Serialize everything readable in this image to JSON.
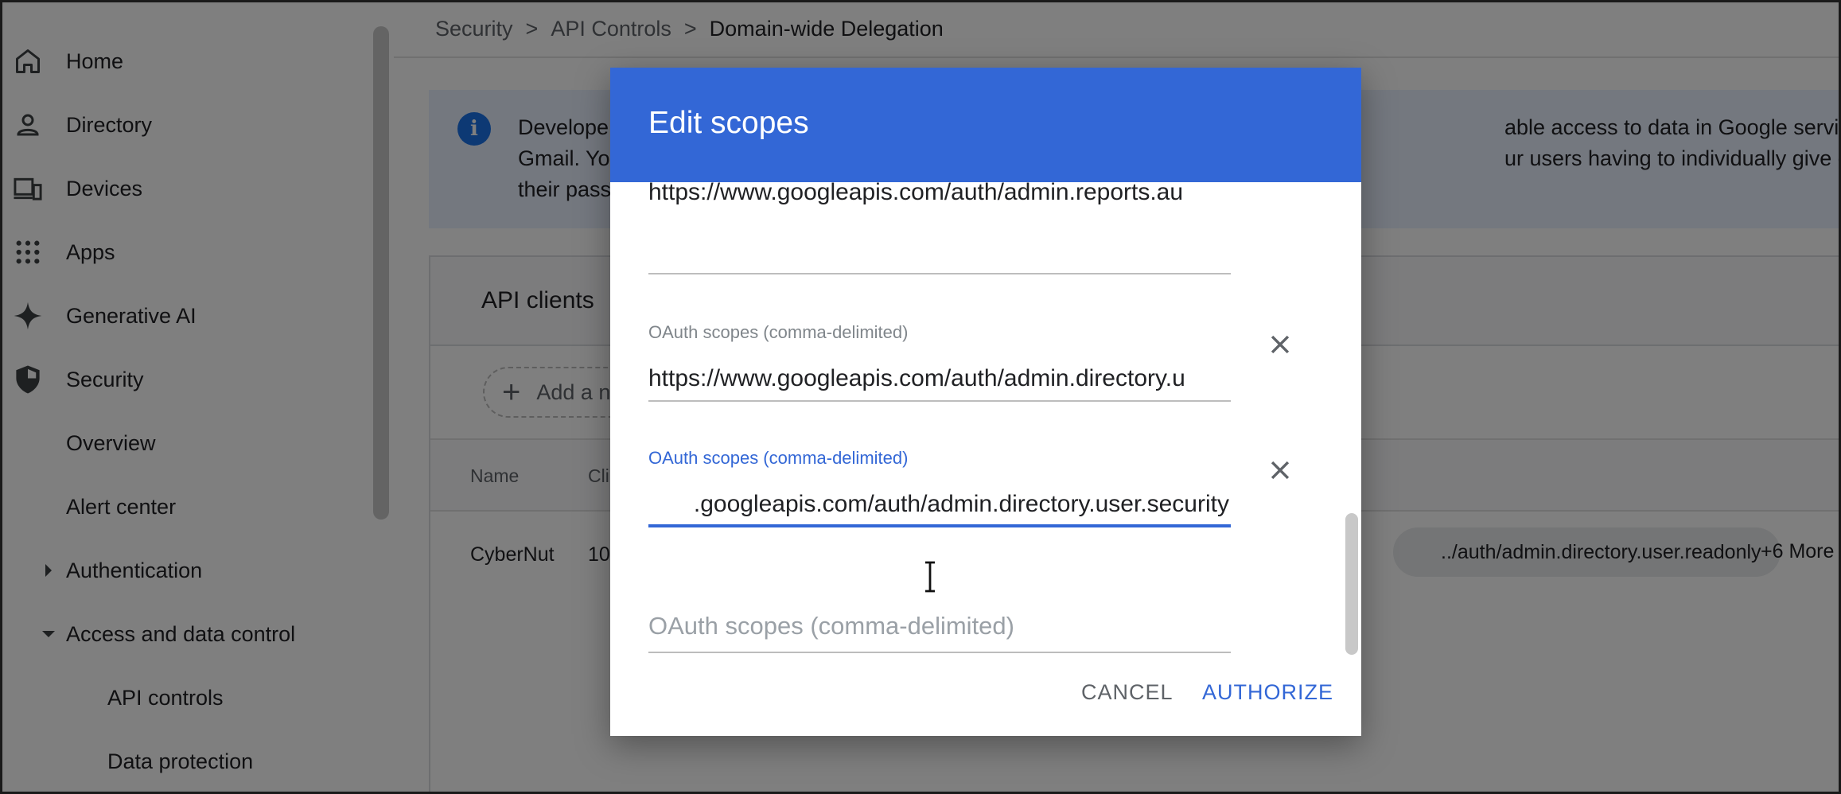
{
  "sidebar": {
    "items": [
      {
        "label": "Home",
        "icon": "home-icon"
      },
      {
        "label": "Directory",
        "icon": "person-icon"
      },
      {
        "label": "Devices",
        "icon": "devices-icon"
      },
      {
        "label": "Apps",
        "icon": "apps-grid-icon"
      },
      {
        "label": "Generative AI",
        "icon": "sparkle-icon"
      },
      {
        "label": "Security",
        "icon": "shield-icon"
      }
    ],
    "sub_items": {
      "overview": "Overview",
      "alert_center": "Alert center",
      "authentication": "Authentication",
      "access_data_control": "Access and data control",
      "api_controls": "API controls",
      "data_protection": "Data protection"
    }
  },
  "breadcrumb": {
    "items": [
      "Security",
      "API Controls"
    ],
    "current": "Domain-wide Delegation",
    "separator": ">"
  },
  "banner": {
    "text_left": "Develope\nGmail. Yo\ntheir pass",
    "text_right": "able access to data in Google services like\nur users having to individually give consent or"
  },
  "api_clients": {
    "title": "API clients",
    "add_button": "Add a n",
    "columns": {
      "name": "Name",
      "client": "Cli"
    },
    "row": {
      "name": "CyberNut",
      "client_id": "10",
      "scope_chip": "../auth/admin.directory.user.readonly",
      "more": "+6 More"
    }
  },
  "dialog": {
    "title": "Edit scopes",
    "scopes": [
      {
        "label": "",
        "value": "https://www.googleapis.com/auth/admin.reports.au"
      },
      {
        "label": "OAuth scopes (comma-delimited)",
        "value": "https://www.googleapis.com/auth/admin.directory.u"
      },
      {
        "label": "OAuth scopes (comma-delimited)",
        "value": ".googleapis.com/auth/admin.directory.user.security"
      }
    ],
    "empty_placeholder": "OAuth scopes (comma-delimited)",
    "cancel": "CANCEL",
    "authorize": "AUTHORIZE"
  },
  "colors": {
    "dialog_header": "#3367d6",
    "accent": "#3367d6",
    "overlay": "rgba(0,0,0,0.5)",
    "banner": "#e8f0fe"
  }
}
